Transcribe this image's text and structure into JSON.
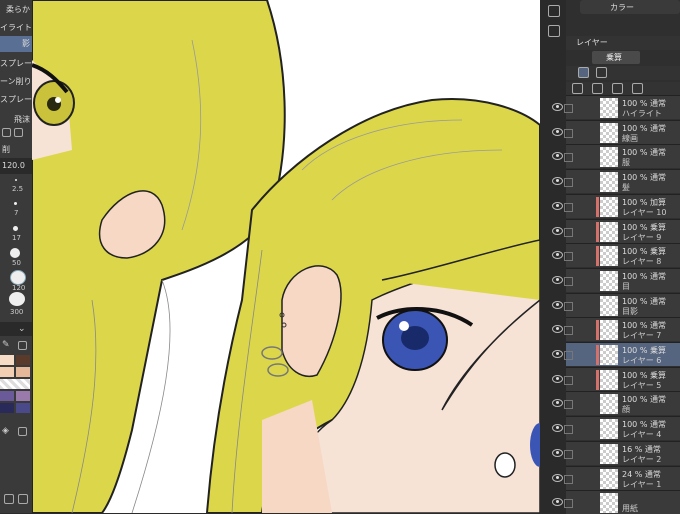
{
  "left_panel": {
    "items": [
      {
        "label": "柔らか",
        "selected": false
      },
      {
        "label": "イライト",
        "selected": false
      },
      {
        "label": "影",
        "selected": true
      },
      {
        "label": "スプレー",
        "selected": false
      },
      {
        "label": "ーン削り",
        "selected": false
      },
      {
        "label": "スプレー",
        "selected": false
      },
      {
        "label": "飛沫",
        "selected": false
      }
    ],
    "brush_label": "削",
    "size_value": "120.0",
    "size_options": [
      "2.5",
      "5",
      "7",
      "10",
      "17",
      "30",
      "50",
      "120",
      "200",
      "300"
    ]
  },
  "right_panel": {
    "color_tab": "カラー",
    "layer_tab": "レイヤー",
    "blend_mode": "乗算",
    "layers": [
      {
        "percent": "100 %",
        "mode": "通常",
        "name": "ハイライト",
        "selected": false,
        "clipped": false
      },
      {
        "percent": "100 %",
        "mode": "通常",
        "name": "線画",
        "selected": false,
        "clipped": false
      },
      {
        "percent": "100 %",
        "mode": "通常",
        "name": "服",
        "selected": false,
        "clipped": false
      },
      {
        "percent": "100 %",
        "mode": "通常",
        "name": "髪",
        "selected": false,
        "clipped": false
      },
      {
        "percent": "100 %",
        "mode": "加算",
        "name": "レイヤー 10",
        "selected": false,
        "clipped": true
      },
      {
        "percent": "100 %",
        "mode": "乗算",
        "name": "レイヤー 9",
        "selected": false,
        "clipped": true
      },
      {
        "percent": "100 %",
        "mode": "乗算",
        "name": "レイヤー 8",
        "selected": false,
        "clipped": true
      },
      {
        "percent": "100 %",
        "mode": "通常",
        "name": "目",
        "selected": false,
        "clipped": false
      },
      {
        "percent": "100 %",
        "mode": "通常",
        "name": "目影",
        "selected": false,
        "clipped": false
      },
      {
        "percent": "100 %",
        "mode": "通常",
        "name": "レイヤー 7",
        "selected": false,
        "clipped": true
      },
      {
        "percent": "100 %",
        "mode": "乗算",
        "name": "レイヤー 6",
        "selected": true,
        "clipped": true
      },
      {
        "percent": "100 %",
        "mode": "乗算",
        "name": "レイヤー 5",
        "selected": false,
        "clipped": true
      },
      {
        "percent": "100 %",
        "mode": "通常",
        "name": "顔",
        "selected": false,
        "clipped": false
      },
      {
        "percent": "100 %",
        "mode": "通常",
        "name": "レイヤー 4",
        "selected": false,
        "clipped": false
      },
      {
        "percent": "16 %",
        "mode": "通常",
        "name": "レイヤー 2",
        "selected": false,
        "clipped": false
      },
      {
        "percent": "24 %",
        "mode": "通常",
        "name": "レイヤー 1",
        "selected": false,
        "clipped": false
      },
      {
        "percent": "",
        "mode": "",
        "name": "用紙",
        "selected": false,
        "clipped": false
      }
    ]
  },
  "colors": {
    "hair": "#dcd74a",
    "skin": "#f7e2d6",
    "eye_blue": "#3b55b5",
    "eye_yellow": "#c9c23a",
    "selection": "#56657f"
  }
}
